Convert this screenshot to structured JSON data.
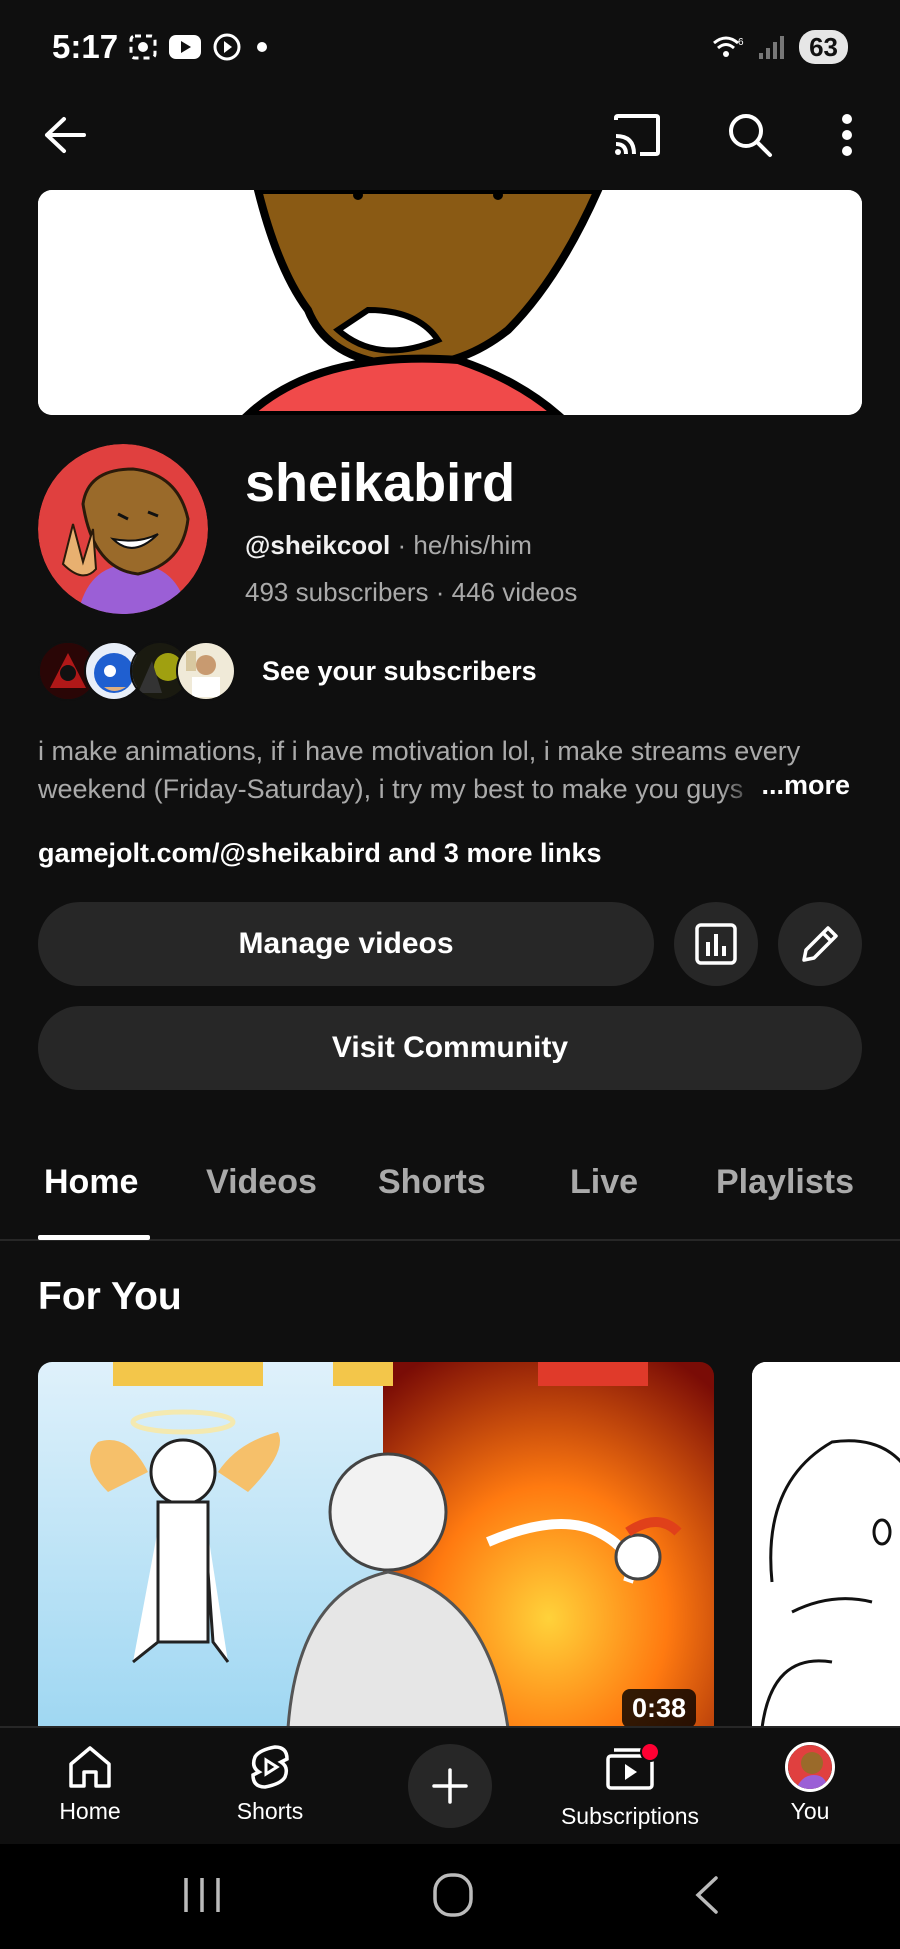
{
  "status_bar": {
    "time": "5:17",
    "battery": "63",
    "icons": [
      "screen-record-icon",
      "youtube-icon",
      "media-icon",
      "dot-icon",
      "wifi-icon",
      "signal-icon"
    ]
  },
  "top_bar": {
    "icons": [
      "back-arrow-icon",
      "cast-icon",
      "search-icon",
      "more-vert-icon"
    ]
  },
  "channel": {
    "name": "sheikabird",
    "handle": "@sheikcool",
    "pronouns": "he/his/him",
    "subscribers": "493 subscribers",
    "videos": "446 videos",
    "see_subscribers": "See your subscribers",
    "description": "i make animations, if i have motivation lol, i make streams every weekend (Friday-Saturday), i try my best to make you guys",
    "more_label": "...more",
    "links": "gamejolt.com/@sheikabird and 3 more links"
  },
  "actions": {
    "manage_videos": "Manage videos",
    "visit_community": "Visit Community",
    "icons": [
      "analytics-icon",
      "edit-pencil-icon"
    ]
  },
  "tabs": [
    {
      "label": "Home",
      "active": true
    },
    {
      "label": "Videos"
    },
    {
      "label": "Shorts"
    },
    {
      "label": "Live"
    },
    {
      "label": "Playlists"
    }
  ],
  "section": {
    "title": "For You",
    "video_duration": "0:38"
  },
  "bottom_nav": [
    {
      "label": "Home",
      "icon": "home-icon"
    },
    {
      "label": "Shorts",
      "icon": "shorts-icon"
    },
    {
      "label": "",
      "icon": "create-plus-icon"
    },
    {
      "label": "Subscriptions",
      "icon": "subscriptions-icon"
    },
    {
      "label": "You",
      "icon": "you-avatar-icon"
    }
  ],
  "system_nav": [
    "recents-icon",
    "home-circle-icon",
    "back-chevron-icon"
  ]
}
